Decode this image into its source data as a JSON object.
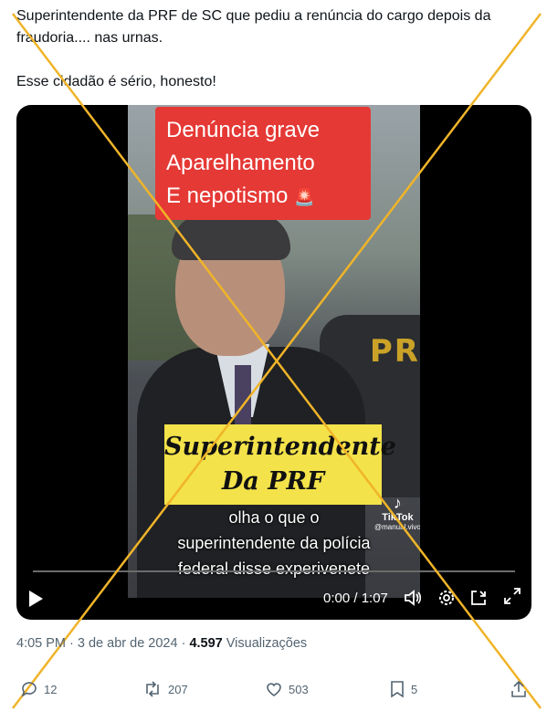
{
  "tweet": {
    "line1": "Superintendente da PRF de SC que pediu a renúncia do cargo depois da",
    "line2": "fraudoria.... nas urnas.",
    "line3": "Esse cidadão é sério, honesto!"
  },
  "video": {
    "red_banner": [
      "Denúncia grave",
      "Aparelhamento",
      "E nepotismo"
    ],
    "siren_icon": "🚨",
    "yellow_banner": [
      "Superintendente",
      "Da PRF"
    ],
    "caption": [
      "olha o que o",
      "superintendente da polícia",
      "federal disse experivenete"
    ],
    "car_label": "PR",
    "tiktok_label": "TikTok",
    "tiktok_handle": "@manual.vivo",
    "time": "0:00 / 1:07",
    "icons": [
      "play-icon",
      "volume-icon",
      "settings-icon",
      "subtitles-icon",
      "fullscreen-icon"
    ],
    "colors": {
      "red": "#e53935",
      "yellow": "#f3e24a"
    }
  },
  "meta": {
    "time": "4:05 PM",
    "sep1": " · ",
    "date": "3 de abr de 2024",
    "sep2": " · ",
    "views_count": "4.597",
    "views_label": " Visualizações"
  },
  "actions": {
    "replies": "12",
    "reposts": "207",
    "likes": "503",
    "bookmarks": "5"
  },
  "overlay": {
    "cross_color": "#f0b429"
  }
}
